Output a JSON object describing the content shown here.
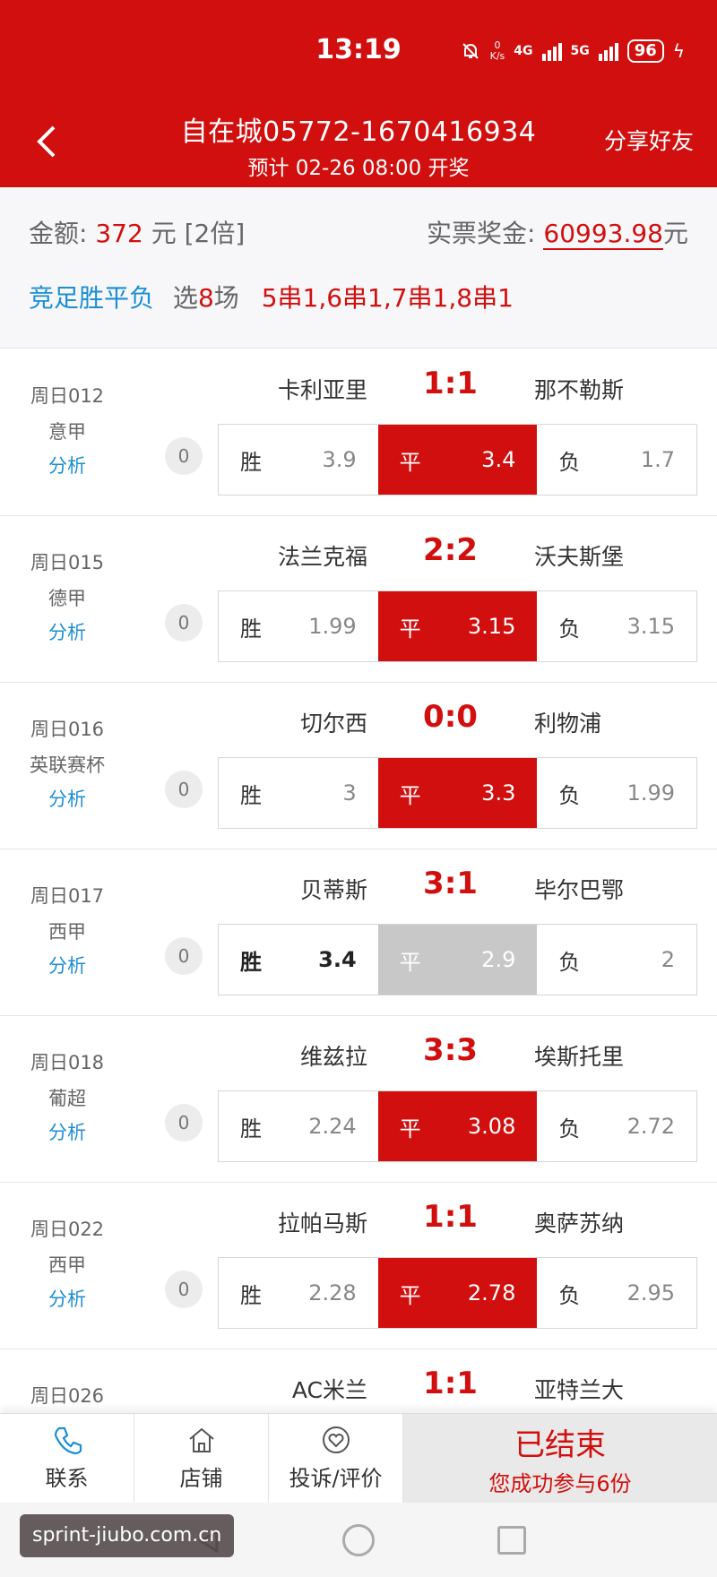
{
  "status_bar": {
    "time": "13:19",
    "net_speed_top": "0",
    "net_speed_bottom": "K/s",
    "net1": "4G",
    "net2": "5G",
    "battery": "96"
  },
  "header": {
    "title": "自在城05772-1670416934",
    "subtitle": "预计 02-26 08:00 开奖",
    "share_label": "分享好友"
  },
  "summary": {
    "amount_label": "金额:",
    "amount_value": "372",
    "amount_unit": "元 [2倍]",
    "prize_label": "实票奖金:",
    "prize_value": "60993.98",
    "prize_unit": "元",
    "play_type": "竞足胜平负",
    "select_label": "选",
    "select_count": "8",
    "select_unit": "场",
    "combos": "5串1,6串1,7串1,8串1"
  },
  "matches": [
    {
      "date": "周日012",
      "league": "意甲",
      "analysis": "分析",
      "home": "卡利亚里",
      "score": "1:1",
      "away": "那不勒斯",
      "count": "0",
      "win_label": "胜",
      "win_odds": "3.9",
      "draw_label": "平",
      "draw_odds": "3.4",
      "lose_label": "负",
      "lose_odds": "1.7"
    },
    {
      "date": "周日015",
      "league": "德甲",
      "analysis": "分析",
      "home": "法兰克福",
      "score": "2:2",
      "away": "沃夫斯堡",
      "count": "0",
      "win_label": "胜",
      "win_odds": "1.99",
      "draw_label": "平",
      "draw_odds": "3.15",
      "lose_label": "负",
      "lose_odds": "3.15"
    },
    {
      "date": "周日016",
      "league": "英联赛杯",
      "analysis": "分析",
      "home": "切尔西",
      "score": "0:0",
      "away": "利物浦",
      "count": "0",
      "win_label": "胜",
      "win_odds": "3",
      "draw_label": "平",
      "draw_odds": "3.3",
      "lose_label": "负",
      "lose_odds": "1.99"
    },
    {
      "date": "周日017",
      "league": "西甲",
      "analysis": "分析",
      "home": "贝蒂斯",
      "score": "3:1",
      "away": "毕尔巴鄂",
      "count": "0",
      "win_label": "胜",
      "win_odds": "3.4",
      "draw_label": "平",
      "draw_odds": "2.9",
      "lose_label": "负",
      "lose_odds": "2"
    },
    {
      "date": "周日018",
      "league": "葡超",
      "analysis": "分析",
      "home": "维兹拉",
      "score": "3:3",
      "away": "埃斯托里",
      "count": "0",
      "win_label": "胜",
      "win_odds": "2.24",
      "draw_label": "平",
      "draw_odds": "3.08",
      "lose_label": "负",
      "lose_odds": "2.72"
    },
    {
      "date": "周日022",
      "league": "西甲",
      "analysis": "分析",
      "home": "拉帕马斯",
      "score": "1:1",
      "away": "奥萨苏纳",
      "count": "0",
      "win_label": "胜",
      "win_odds": "2.28",
      "draw_label": "平",
      "draw_odds": "2.78",
      "lose_label": "负",
      "lose_odds": "2.95"
    },
    {
      "date": "周日026",
      "league": "",
      "analysis": "",
      "home": "AC米兰",
      "score": "1:1",
      "away": "亚特兰大",
      "count": "",
      "win_label": "",
      "win_odds": "",
      "draw_label": "",
      "draw_odds": "",
      "lose_label": "",
      "lose_odds": ""
    }
  ],
  "bottom_bar": {
    "contact": "联系",
    "shop": "店铺",
    "feedback": "投诉/评价",
    "status_title": "已结束",
    "status_sub": "您成功参与6份"
  },
  "watermark": "sprint-jiubo.com.cn",
  "colors": {
    "primary_red": "#d20f0f",
    "link_blue": "#1b8ed6",
    "ended_bg": "#e9e9e9"
  }
}
